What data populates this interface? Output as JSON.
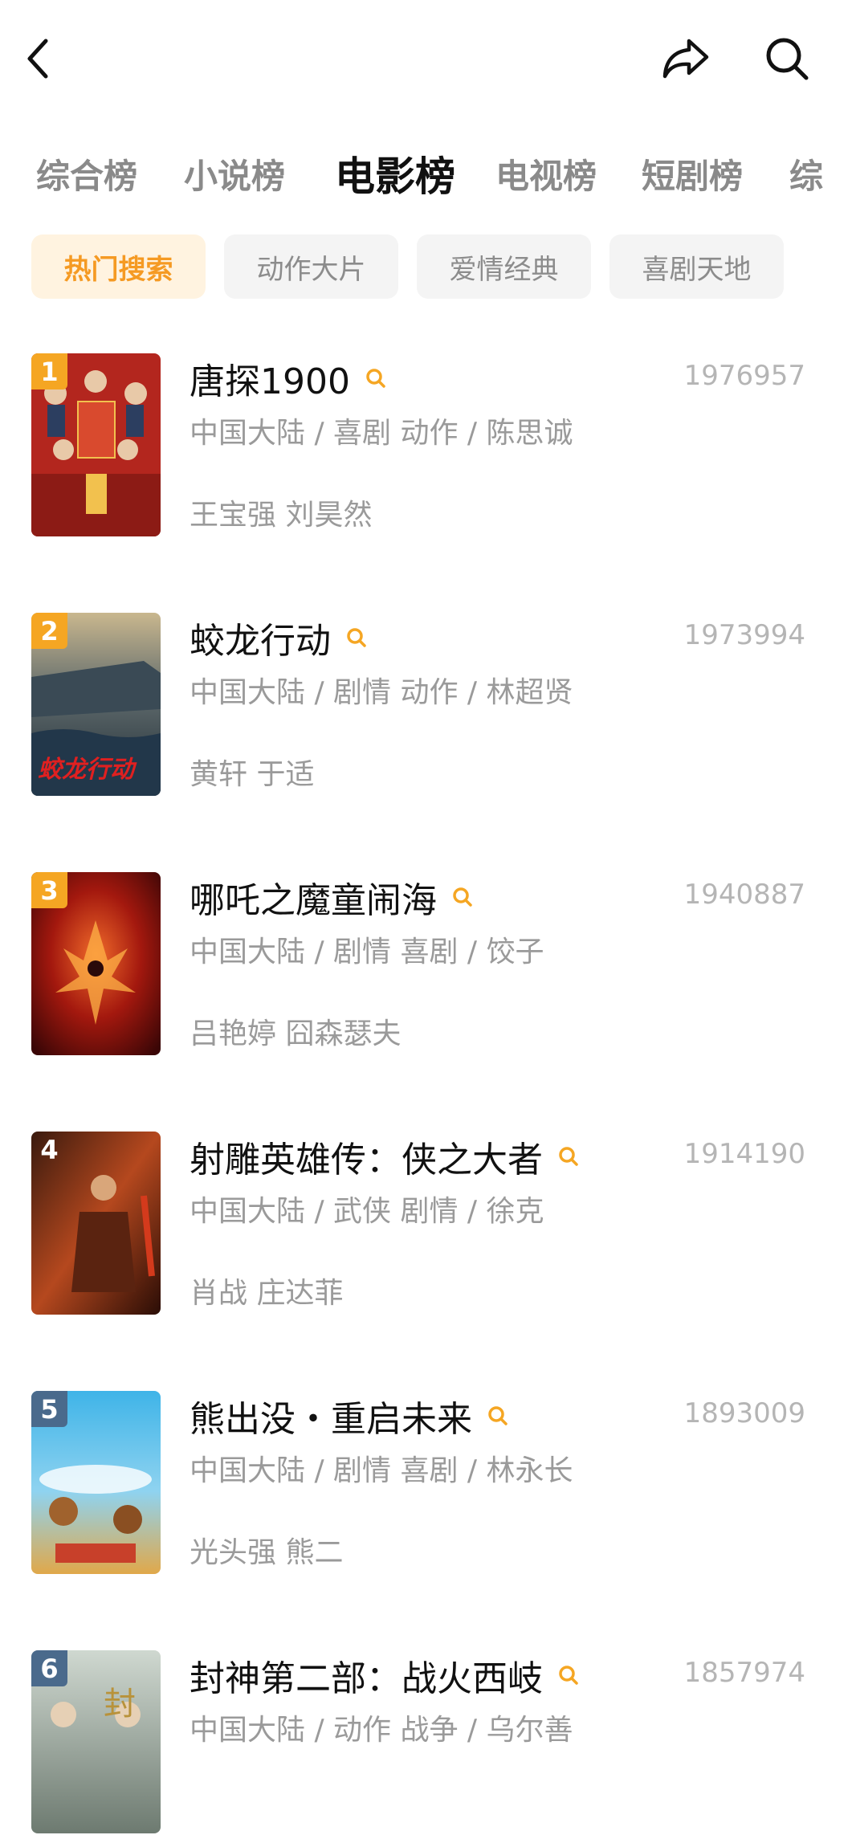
{
  "header": {
    "back_icon": "back-arrow-icon",
    "share_icon": "share-icon",
    "search_icon": "search-icon"
  },
  "tabs": [
    {
      "label": "综合榜",
      "active": false
    },
    {
      "label": "小说榜",
      "active": false
    },
    {
      "label": "电影榜",
      "active": true
    },
    {
      "label": "电视榜",
      "active": false
    },
    {
      "label": "短剧榜",
      "active": false
    },
    {
      "label": "综",
      "active": false
    }
  ],
  "chips": [
    {
      "label": "热门搜索",
      "active": true
    },
    {
      "label": "动作大片",
      "active": false
    },
    {
      "label": "爱情经典",
      "active": false
    },
    {
      "label": "喜剧天地",
      "active": false
    }
  ],
  "colors": {
    "accent": "#f5a623",
    "active_chip_text": "#f59a23",
    "active_chip_bg": "#fff3e0"
  },
  "movies": [
    {
      "rank": "1",
      "title": "唐探1900",
      "score": "1976957",
      "meta": "中国大陆 / 喜剧 动作 / 陈思诚",
      "cast": "王宝强 刘昊然"
    },
    {
      "rank": "2",
      "title": "蛟龙行动",
      "score": "1973994",
      "meta": "中国大陆 / 剧情 动作 / 林超贤",
      "cast": "黄轩 于适"
    },
    {
      "rank": "3",
      "title": "哪吒之魔童闹海",
      "score": "1940887",
      "meta": "中国大陆 / 剧情 喜剧 / 饺子",
      "cast": "吕艳婷 囧森瑟夫"
    },
    {
      "rank": "4",
      "title": "射雕英雄传：侠之大者",
      "score": "1914190",
      "meta": "中国大陆 / 武侠 剧情 / 徐克",
      "cast": "肖战 庄达菲"
    },
    {
      "rank": "5",
      "title": "熊出没・重启未来",
      "score": "1893009",
      "meta": "中国大陆 / 剧情 喜剧 / 林永长",
      "cast": "光头强 熊二"
    },
    {
      "rank": "6",
      "title": "封神第二部：战火西岐",
      "score": "1857974",
      "meta": "中国大陆 / 动作 战争 / 乌尔善",
      "cast": ""
    }
  ]
}
